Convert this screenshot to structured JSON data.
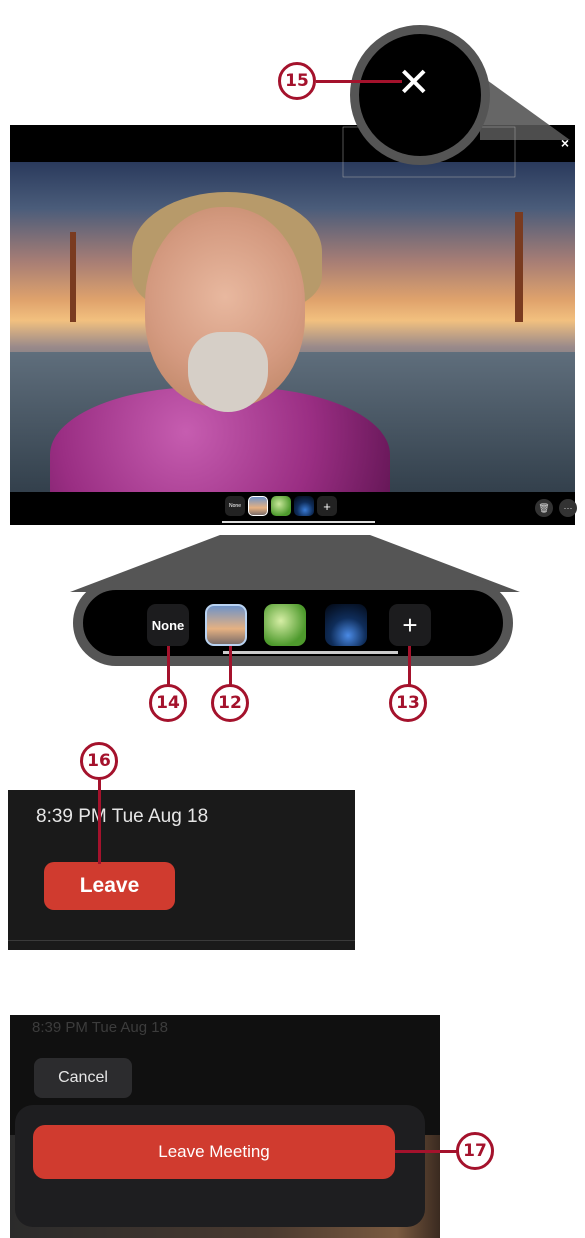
{
  "callouts": {
    "c12": "12",
    "c13": "13",
    "c14": "14",
    "c15": "15",
    "c16": "16",
    "c17": "17"
  },
  "screen": {
    "close_glyph": "×",
    "thumb_none": "None",
    "thumb_add": "+",
    "trash_glyph": "🗑",
    "more_glyph": "···"
  },
  "magnifier": {
    "close_glyph": "✕"
  },
  "zoom_bar": {
    "none_label": "None",
    "add_label": "+"
  },
  "leave_panel": {
    "time_date": "8:39 PM   Tue Aug 18",
    "leave_label": "Leave"
  },
  "leave_sheet": {
    "time_date": "8:39 PM   Tue Aug 18",
    "cancel_label": "Cancel",
    "leave_meeting_label": "Leave Meeting"
  },
  "colors": {
    "callout": "#a4122c",
    "leave_red": "#d03b2f"
  },
  "icons": [
    "close-icon",
    "plus-icon",
    "trash-icon",
    "more-icon"
  ]
}
